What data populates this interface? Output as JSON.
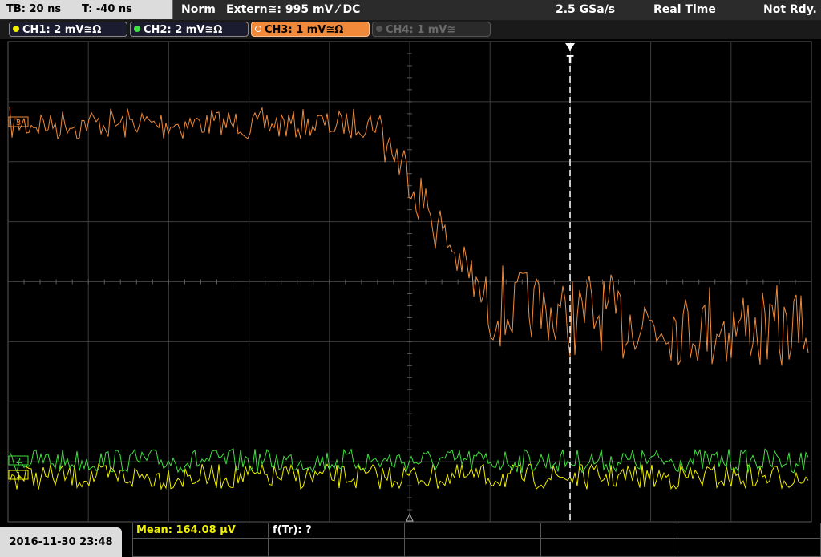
{
  "header": {
    "timebase": "TB: 20 ns",
    "trigger_time": "T: -40 ns",
    "trigger_mode": "Norm",
    "trigger_source": "Extern≅: 995 mV ⁄ DC",
    "sample_rate": "2.5 GSa/s",
    "acq_mode": "Real Time",
    "status": "Not Rdy."
  },
  "channels": [
    {
      "label": "CH1: 2 mV≅Ω",
      "color": "#f0f000",
      "state": "normal"
    },
    {
      "label": "CH2: 2 mV≅Ω",
      "color": "#40e040",
      "state": "normal"
    },
    {
      "label": "CH3: 1 mV≅Ω",
      "color": "#f08a3a",
      "state": "active"
    },
    {
      "label": "CH4: 1 mV≅",
      "color": "#6a6a6a",
      "state": "off"
    }
  ],
  "measurements": {
    "mean": "Mean: 164.08 µV",
    "rise_freq": "f(Tr): ?"
  },
  "footer": {
    "datetime": "2016-11-30 23:48"
  },
  "markers": {
    "trigger_label": "T",
    "ch3_ref": "3",
    "ch2_ref": "2",
    "ch1_ref": "1"
  },
  "colors": {
    "grid": "#3c3c3c",
    "ch3": "#f08a3a",
    "ch2": "#40e040",
    "ch1": "#f0f000"
  }
}
